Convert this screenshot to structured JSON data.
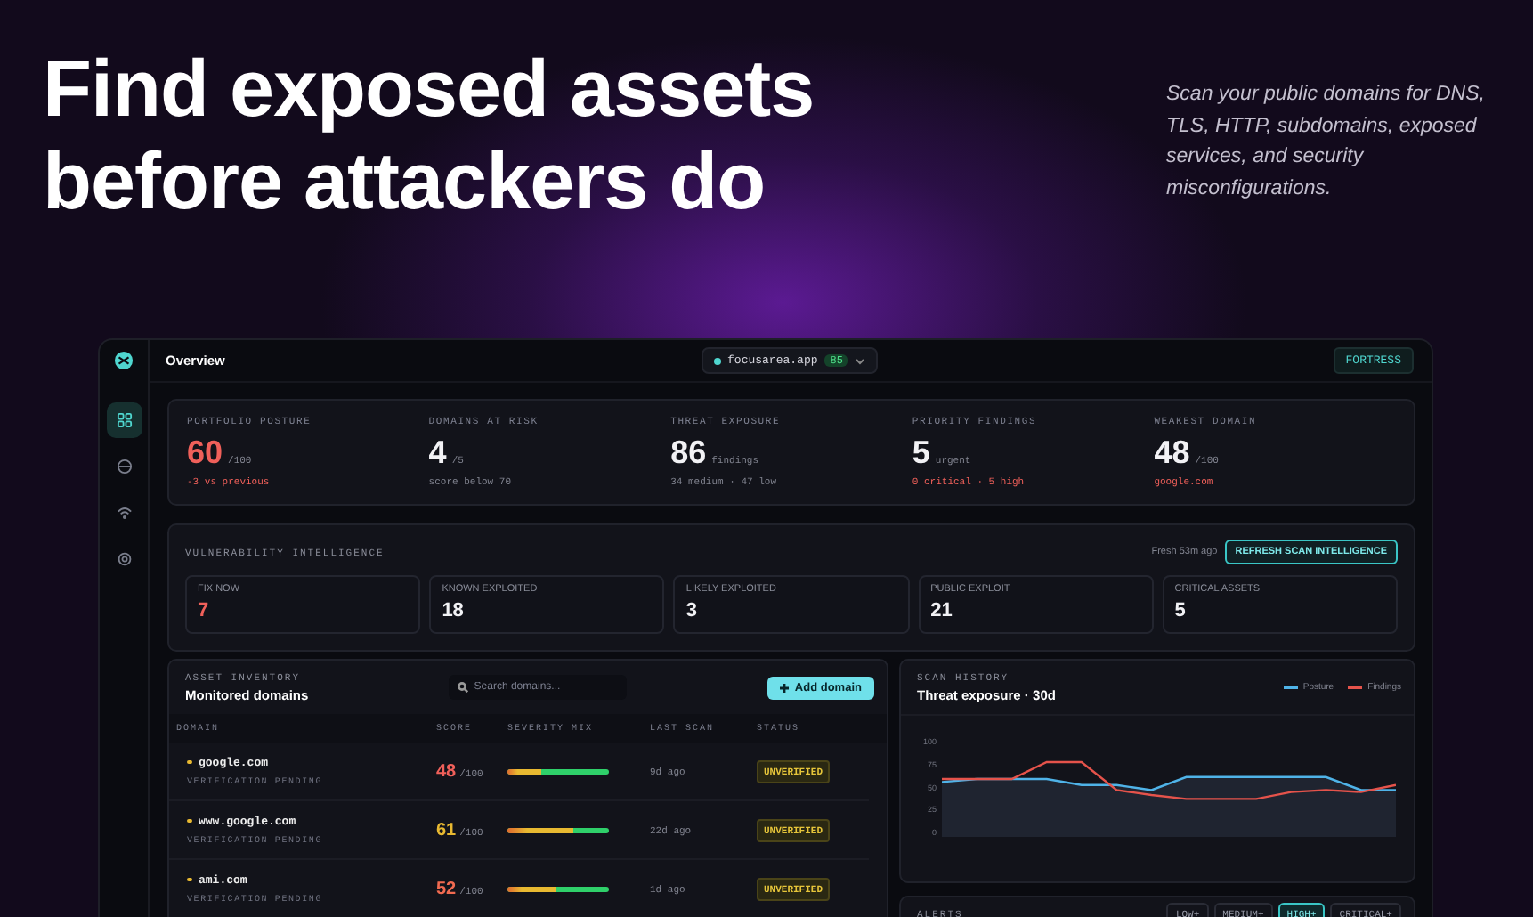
{
  "hero": {
    "title_lines": [
      "Find exposed assets",
      "before attackers do"
    ],
    "description": "Scan your public domains for DNS, TLS, HTTP, subdomains, exposed services, and security misconfigurations."
  },
  "sidebar": {
    "items": [
      {
        "selected": true
      },
      {
        "selected": false
      },
      {
        "selected": false
      },
      {
        "selected": false
      }
    ]
  },
  "topbar": {
    "title": "Overview",
    "domain": "focusarea.app",
    "domain_score": "85",
    "plan_button": "FORTRESS"
  },
  "stats": [
    {
      "label": "PORTFOLIO POSTURE",
      "value": "60",
      "unit": "/100",
      "note": "-3 vs previous",
      "value_alert": true,
      "note_alert": true
    },
    {
      "label": "DOMAINS AT RISK",
      "value": "4",
      "unit": "/5",
      "note": "score below 70",
      "value_alert": false,
      "note_alert": false
    },
    {
      "label": "THREAT EXPOSURE",
      "value": "86",
      "unit": "findings",
      "note": "34 medium · 47 low",
      "value_alert": false,
      "note_alert": false
    },
    {
      "label": "PRIORITY FINDINGS",
      "value": "5",
      "unit": "urgent",
      "note": "0 critical · 5 high",
      "value_alert": false,
      "note_alert": true
    },
    {
      "label": "WEAKEST DOMAIN",
      "value": "48",
      "unit": "/100",
      "note": "google.com",
      "value_alert": false,
      "note_alert": true
    }
  ],
  "intel": {
    "title": "VULNERABILITY INTELLIGENCE",
    "freshness": "Fresh 53m ago",
    "refresh_button": "REFRESH SCAN INTELLIGENCE",
    "tiles": [
      {
        "label": "FIX NOW",
        "value": "7",
        "alert": true
      },
      {
        "label": "KNOWN EXPLOITED",
        "value": "18",
        "alert": false
      },
      {
        "label": "LIKELY EXPLOITED",
        "value": "3",
        "alert": false
      },
      {
        "label": "PUBLIC EXPLOIT",
        "value": "21",
        "alert": false
      },
      {
        "label": "CRITICAL ASSETS",
        "value": "5",
        "alert": false
      }
    ]
  },
  "inventory": {
    "eyebrow": "ASSET INVENTORY",
    "title": "Monitored domains",
    "search": {
      "placeholder": "Search domains..."
    },
    "add_button": "Add domain",
    "columns": [
      "DOMAIN",
      "SCORE",
      "SEVERITY MIX",
      "LAST SCAN",
      "STATUS"
    ],
    "rows": [
      {
        "domain": "google.com",
        "sub": "VERIFICATION PENDING",
        "score": "48",
        "score_max": "/100",
        "color": "#f0605a",
        "level": 0.33,
        "last_scan": "9d ago",
        "status": "UNVERIFIED"
      },
      {
        "domain": "www.google.com",
        "sub": "VERIFICATION PENDING",
        "score": "61",
        "score_max": "/100",
        "color": "#e8b931",
        "level": 0.65,
        "last_scan": "22d ago",
        "status": "UNVERIFIED"
      },
      {
        "domain": "ami.com",
        "sub": "VERIFICATION PENDING",
        "score": "52",
        "score_max": "/100",
        "color": "#f06a50",
        "level": 0.47,
        "last_scan": "1d ago",
        "status": "UNVERIFIED"
      }
    ]
  },
  "history": {
    "eyebrow": "SCAN HISTORY",
    "title": "Threat exposure · 30d",
    "chart_data": {
      "type": "line",
      "ylim": [
        0,
        100
      ],
      "yticks": [
        100,
        75,
        50,
        25,
        0
      ],
      "series": [
        {
          "name": "Posture",
          "color": "#4fb3e8",
          "values": [
            55,
            58,
            58,
            58,
            52,
            52,
            47,
            60,
            60,
            60,
            60,
            60,
            47,
            47
          ]
        },
        {
          "name": "Findings",
          "color": "#e5534b",
          "values": [
            58,
            58,
            58,
            75,
            75,
            47,
            42,
            38,
            38,
            38,
            45,
            47,
            45,
            52
          ]
        }
      ]
    }
  },
  "alerts": {
    "title": "ALERTS",
    "filters": [
      {
        "label": "LOW+",
        "selected": false
      },
      {
        "label": "MEDIUM+",
        "selected": false
      },
      {
        "label": "HIGH+",
        "selected": true
      },
      {
        "label": "CRITICAL+",
        "selected": false
      }
    ]
  }
}
